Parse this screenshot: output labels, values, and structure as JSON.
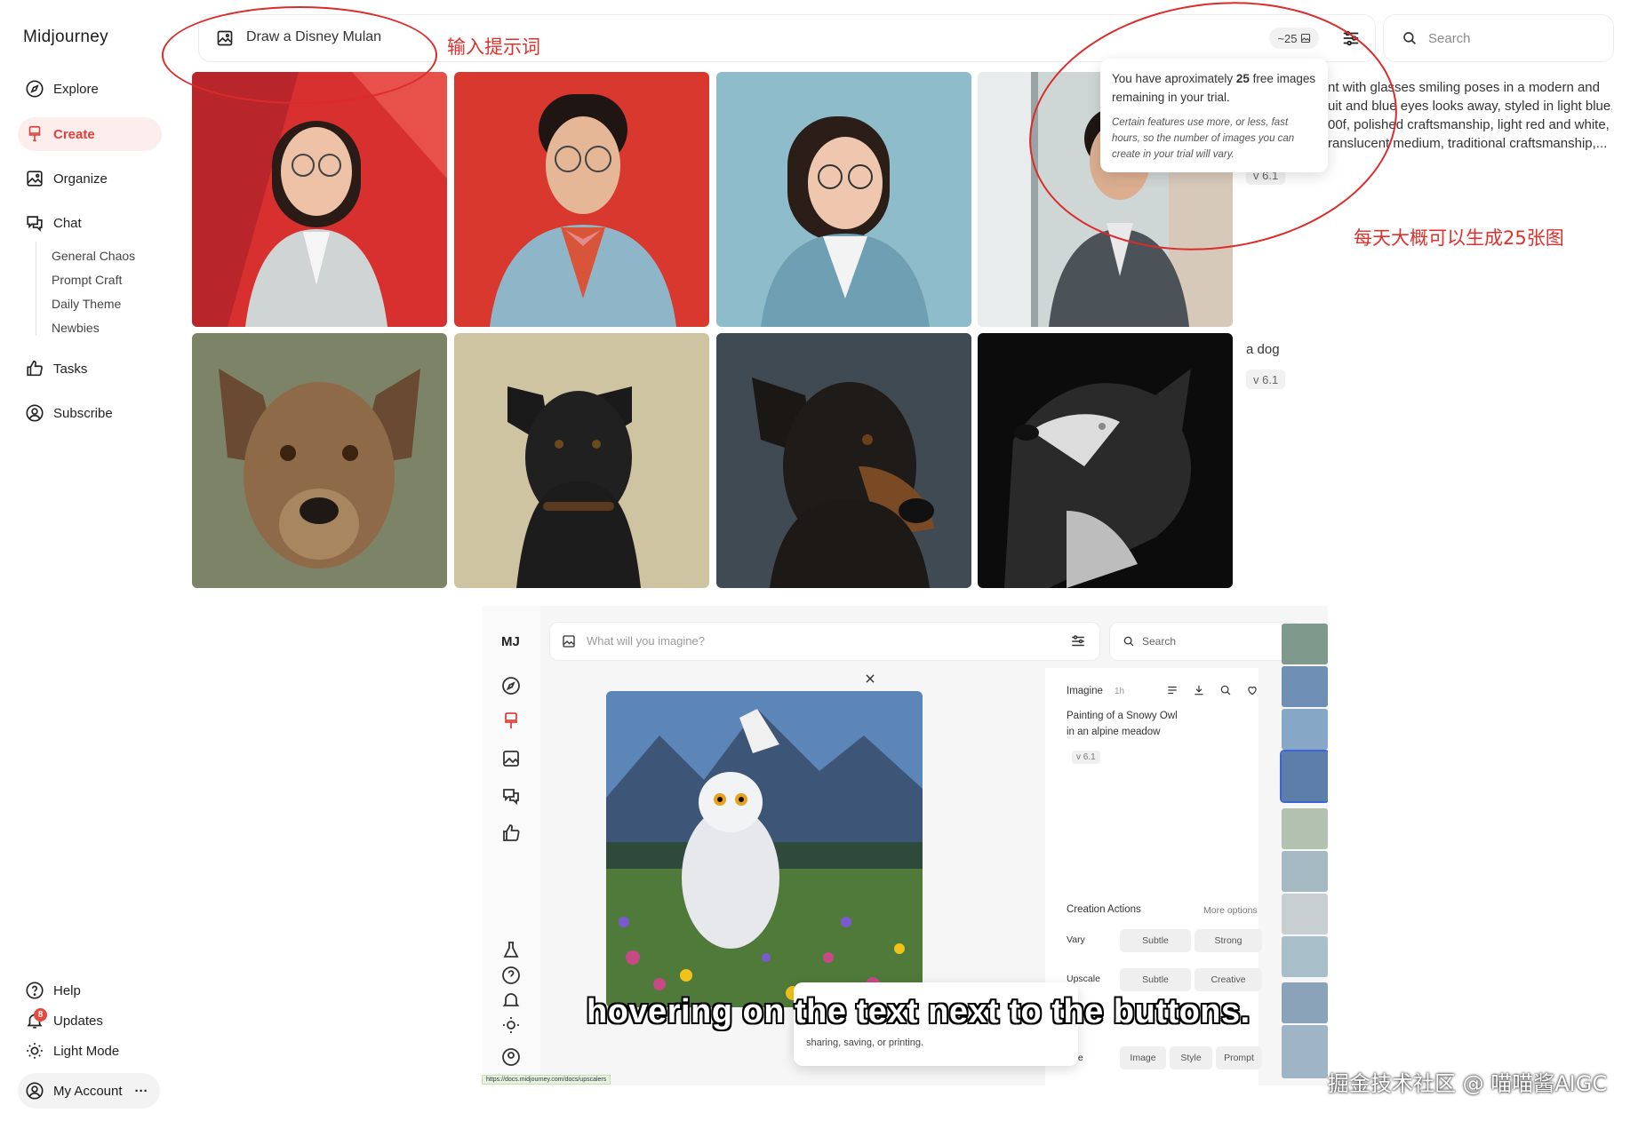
{
  "app": {
    "title": "Midjourney"
  },
  "sidebar": {
    "items": [
      {
        "label": "Explore",
        "icon": "compass-icon"
      },
      {
        "label": "Create",
        "icon": "brush-icon",
        "active": true
      },
      {
        "label": "Organize",
        "icon": "image-icon"
      },
      {
        "label": "Chat",
        "icon": "chat-icon"
      },
      {
        "label": "Tasks",
        "icon": "thumbs-up-icon"
      },
      {
        "label": "Subscribe",
        "icon": "user-circle-icon"
      }
    ],
    "channels": [
      "General Chaos",
      "Prompt Craft",
      "Daily Theme",
      "Newbies"
    ],
    "bottom": [
      {
        "label": "Help",
        "icon": "help-icon"
      },
      {
        "label": "Updates",
        "icon": "bell-icon",
        "badge": "8"
      },
      {
        "label": "Light Mode",
        "icon": "sun-icon"
      }
    ],
    "account": {
      "label": "My Account",
      "more": "···"
    }
  },
  "topbar": {
    "prompt": "Draw a Disney Mulan",
    "credits": "~25",
    "search_placeholder": "Search"
  },
  "tooltip": {
    "line1_pre": "You have aproximately ",
    "line1_count": "25",
    "line1_post": " free images remaining in your trial.",
    "line2": "Certain features use more, or less, fast hours, so the number of images you can create in your trial will vary."
  },
  "jobs": [
    {
      "description_lines": [
        "nt with glasses smiling poses in a modern and",
        "uit and blue eyes looks away, styled in light blue,",
        "00f, polished craftsmanship, light red and white,",
        "ranslucent medium, traditional craftsmanship,..."
      ],
      "version": "v 6.1"
    },
    {
      "prompt": "a dog",
      "version": "v 6.1"
    }
  ],
  "annotations": {
    "prompt_note": "输入提示词",
    "quota_note": "每天大概可以生成25张图"
  },
  "video": {
    "logo": "MJ",
    "prompt_placeholder": "What will you imagine?",
    "search_placeholder": "Search",
    "detail": {
      "type": "Imagine",
      "age": "1h",
      "prompt_lines": [
        "Painting of a Snowy Owl",
        "in an alpine meadow"
      ],
      "version": "v 6.1",
      "creation_actions": "Creation Actions",
      "more_options": "More options",
      "vary_label": "Vary",
      "vary_buttons": [
        "Subtle",
        "Strong"
      ],
      "upscale_label": "Upscale",
      "upscale_buttons": [
        "Subtle",
        "Creative"
      ],
      "use_label": "Use",
      "use_buttons": [
        "Image",
        "Style",
        "Prompt"
      ]
    },
    "tip_text": "sharing, saving, or printing.",
    "url": "https://docs.midjourney.com/docs/upscalers",
    "caption": "hovering on the text next to the buttons."
  },
  "watermark": "掘金技术社区 @ 喵喵酱AIGC",
  "colors": {
    "accent": "#e0403d",
    "annotation": "#dd2a2a"
  }
}
